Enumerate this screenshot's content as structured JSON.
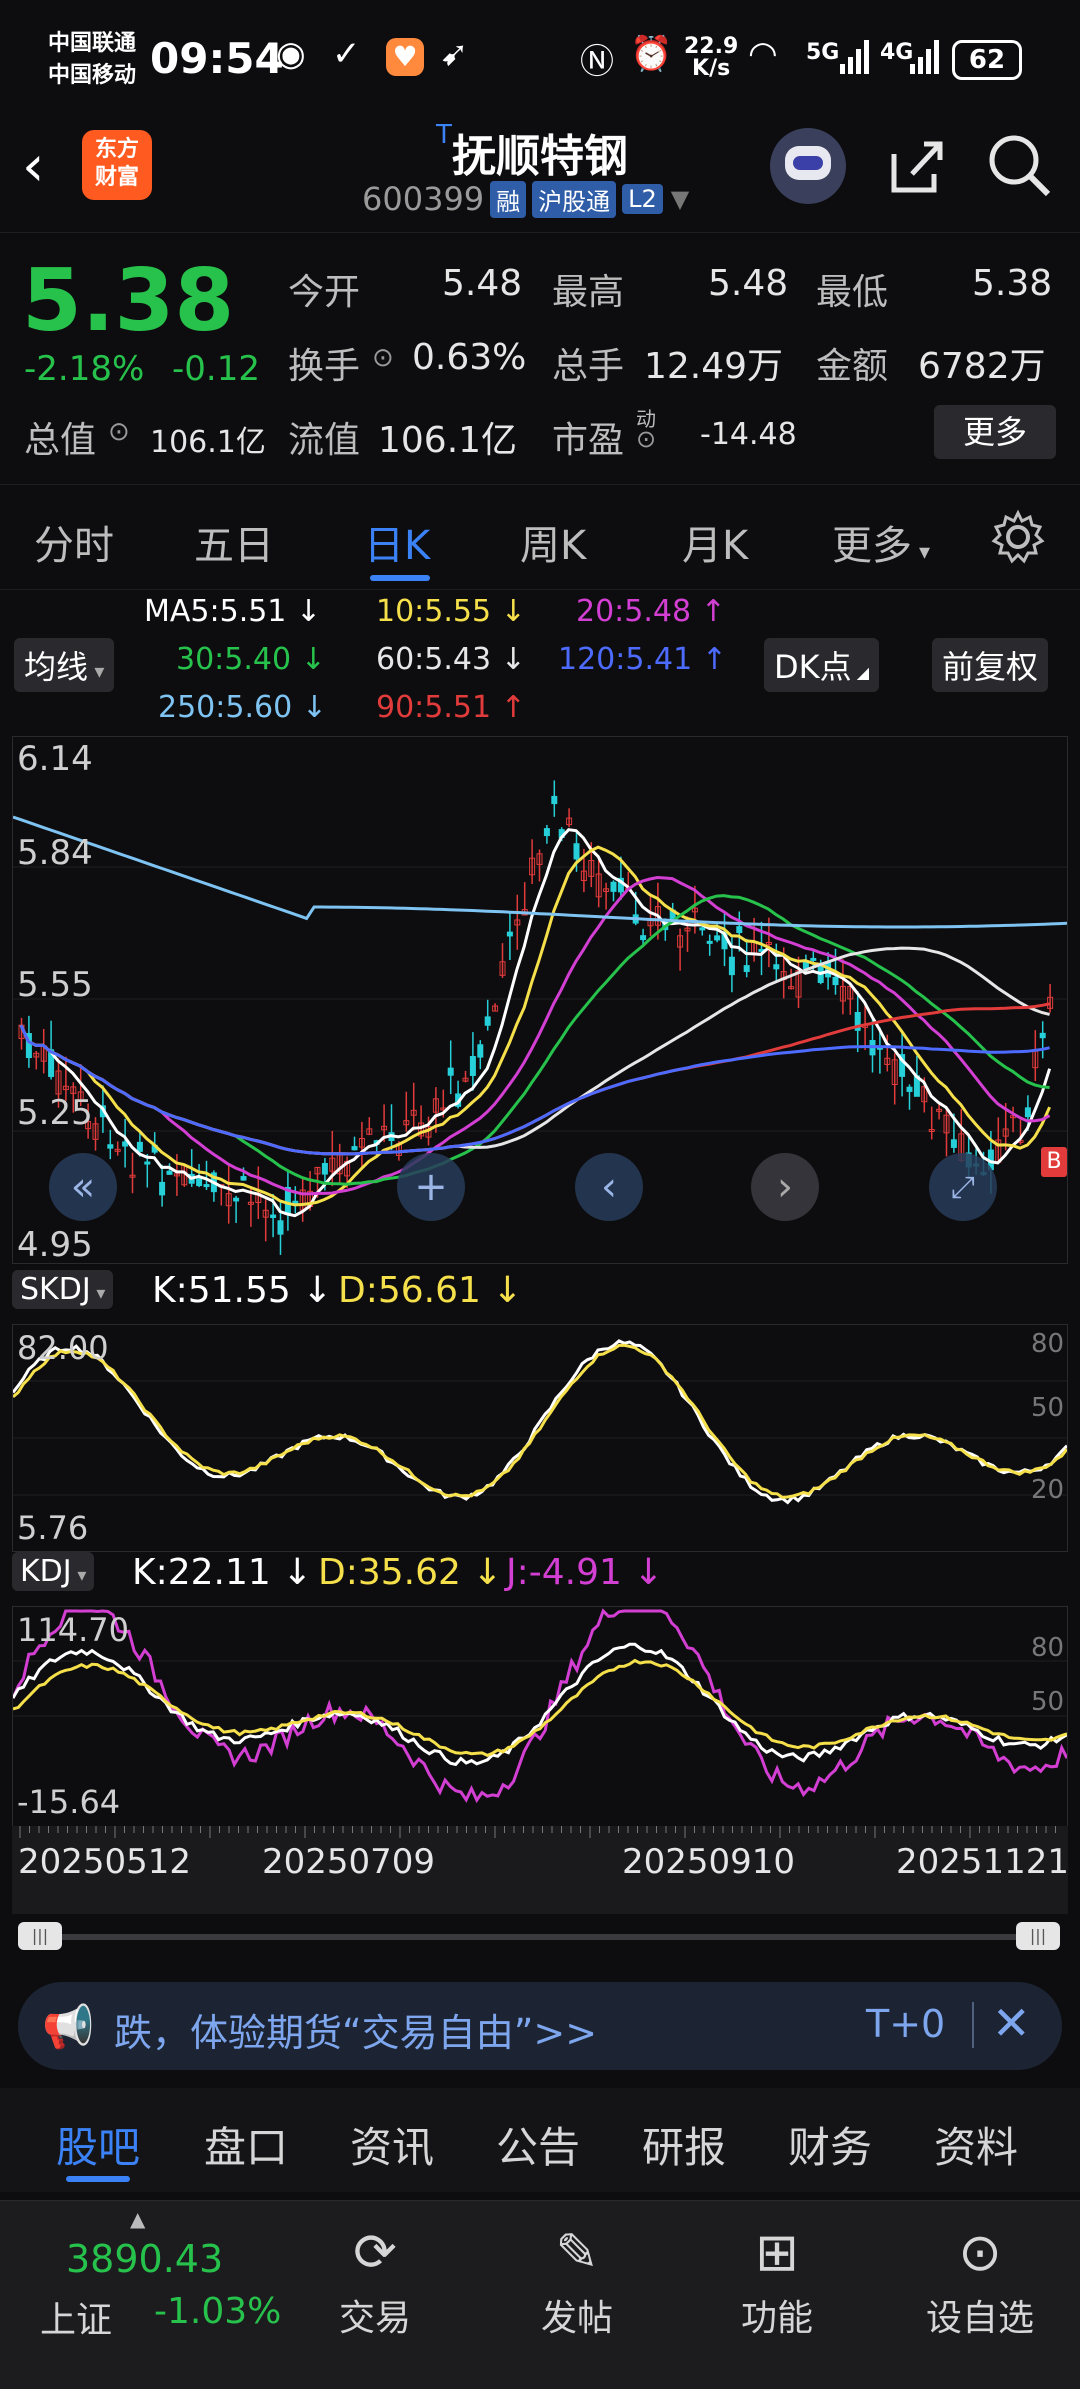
{
  "status_bar": {
    "carrier1": "中国联通",
    "carrier2": "中国移动",
    "time": "09:54",
    "net_speed_value": "22.9",
    "net_speed_unit": "K/s",
    "signal1": "5G",
    "signal2": "4G",
    "battery": "62"
  },
  "header": {
    "app_logo_line1": "东方",
    "app_logo_line2": "财富",
    "tag": "T",
    "stock_name": "抚顺特钢",
    "stock_code": "600399",
    "badges": [
      "融",
      "沪股通",
      "L2"
    ]
  },
  "quote": {
    "price": "5.38",
    "change_pct": "-2.18%",
    "change_abs": "-0.12",
    "open_label": "今开",
    "open_value": "5.48",
    "high_label": "最高",
    "high_value": "5.48",
    "low_label": "最低",
    "low_value": "5.38",
    "turnover_label": "换手",
    "turnover_value": "0.63%",
    "volume_label": "总手",
    "volume_value": "12.49万",
    "amount_label": "金额",
    "amount_value": "6782万",
    "market_cap_label": "总值",
    "market_cap_value": "106.1亿",
    "float_cap_label": "流值",
    "float_cap_value": "106.1亿",
    "pe_label": "市盈",
    "pe_superscript": "动",
    "pe_value": "-14.48",
    "more_button": "更多"
  },
  "chart_tabs": [
    "分时",
    "五日",
    "日K",
    "周K",
    "月K",
    "更多"
  ],
  "active_chart_tab": "日K",
  "ma_panel": {
    "selector": "均线",
    "dk_button": "DK点",
    "adjust_button": "前复权",
    "items": [
      {
        "text": "MA5:5.51 ↓",
        "color": "#ffffff"
      },
      {
        "text": "10:5.55 ↓",
        "color": "#f5e04b"
      },
      {
        "text": "20:5.48 ↑",
        "color": "#d23fd2"
      },
      {
        "text": "30:5.40 ↓",
        "color": "#27c24c"
      },
      {
        "text": "60:5.43 ↓",
        "color": "#e6e6e6"
      },
      {
        "text": "120:5.41 ↑",
        "color": "#4d6bff"
      },
      {
        "text": "250:5.60 ↓",
        "color": "#7ec3f2"
      },
      {
        "text": "90:5.51 ↑",
        "color": "#e23b3b"
      }
    ],
    "y_labels": [
      "6.14",
      "5.84",
      "5.55",
      "5.25",
      "4.95"
    ],
    "marker": "B"
  },
  "skdj": {
    "selector": "SKDJ",
    "k": "K:51.55 ↓",
    "d": "D:56.61 ↓",
    "y_labels": [
      "82.00",
      "5.76"
    ],
    "right_labels": [
      "80",
      "50",
      "20"
    ]
  },
  "kdj": {
    "selector": "KDJ",
    "k": "K:22.11 ↓",
    "d": "D:35.62 ↓",
    "j": "J:-4.91 ↓",
    "y_labels": [
      "114.70",
      "-15.64"
    ],
    "right_labels": [
      "80",
      "50"
    ]
  },
  "dates": [
    "20250512",
    "20250709",
    "20250910",
    "20251121"
  ],
  "banner": {
    "text": "跌，体验期货“交易自由”>>",
    "right_text": "T+0"
  },
  "bottom_tabs": [
    "股吧",
    "盘口",
    "资讯",
    "公告",
    "研报",
    "财务",
    "资料"
  ],
  "active_bottom_tab": "股吧",
  "index": {
    "value": "3890.43",
    "name": "上证",
    "change": "-1.03%"
  },
  "nav": [
    "交易",
    "发帖",
    "功能",
    "设自选"
  ],
  "colors": {
    "accent": "#3b82f6",
    "up": "#e23b3b",
    "down": "#27c24c",
    "background": "#0d0d0f"
  }
}
